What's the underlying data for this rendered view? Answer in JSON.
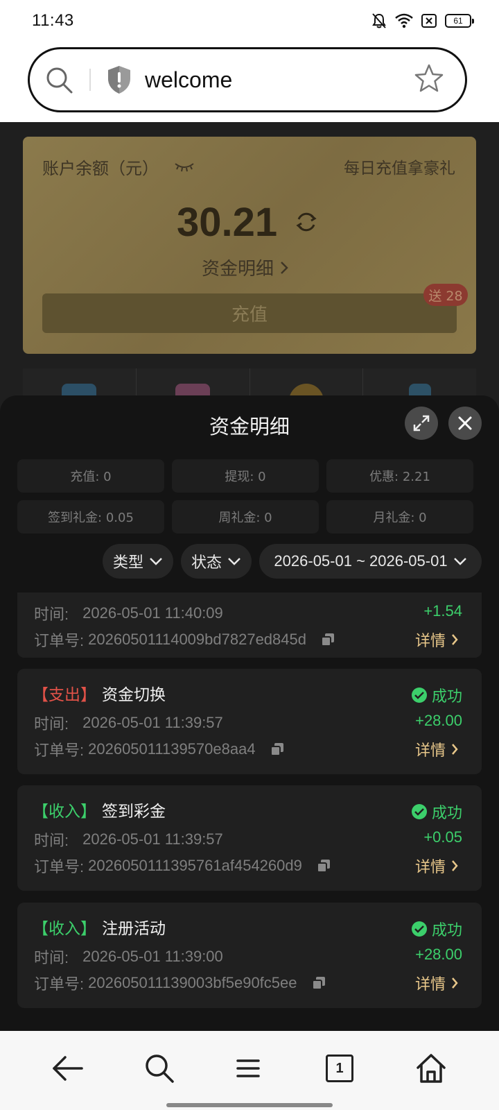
{
  "status_bar": {
    "time": "11:43",
    "battery": "61",
    "icons": [
      "bell-off-icon",
      "wifi-icon",
      "close-box-icon",
      "battery-icon"
    ]
  },
  "address_bar": {
    "text": "welcome",
    "icons": [
      "search-icon",
      "shield-warning-icon",
      "star-icon"
    ]
  },
  "balance": {
    "label": "账户余额（元）",
    "promo": "每日充值拿豪礼",
    "amount": "30.21",
    "detail_link": "资金明细",
    "recharge_label": "充值",
    "gift_badge": "送 28"
  },
  "sheet": {
    "title": "资金明细",
    "stats": [
      {
        "text": "充值: 0"
      },
      {
        "text": "提现: 0"
      },
      {
        "text": "优惠: 2.21"
      },
      {
        "text": "签到礼金: 0.05"
      },
      {
        "text": "周礼金: 0"
      },
      {
        "text": "月礼金: 0"
      }
    ],
    "filters": {
      "type": "类型",
      "status": "状态",
      "date_range": "2026-05-01 ~ 2026-05-01"
    },
    "records": [
      {
        "time_label": "时间:",
        "time": "2026-05-01 11:40:09",
        "order_label": "订单号:",
        "order": "20260501114009bd7827ed845d",
        "amount": "+1.54",
        "detail": "详情"
      },
      {
        "tag": "【支出】",
        "name": "资金切换",
        "status": "成功",
        "time_label": "时间:",
        "time": "2026-05-01 11:39:57",
        "order_label": "订单号:",
        "order": "202605011139570e8aa4",
        "amount": "+28.00",
        "detail": "详情"
      },
      {
        "tag": "【收入】",
        "name": "签到彩金",
        "status": "成功",
        "time_label": "时间:",
        "time": "2026-05-01 11:39:57",
        "order_label": "订单号:",
        "order": "2026050111395761af454260d9",
        "amount": "+0.05",
        "detail": "详情"
      },
      {
        "tag": "【收入】",
        "name": "注册活动",
        "status": "成功",
        "time_label": "时间:",
        "time": "2026-05-01 11:39:00",
        "order_label": "订单号:",
        "order": "202605011139003bf5e90fc5ee",
        "amount": "+28.00",
        "detail": "详情"
      }
    ]
  },
  "bottom_nav": {
    "tab_count": "1",
    "items": [
      "back-arrow-icon",
      "search-icon",
      "menu-icon",
      "tabs-icon",
      "home-icon"
    ]
  },
  "colors": {
    "income": "#3ccf6b",
    "expense": "#e25248",
    "detail_link": "#e8c78a",
    "card_gold": "#8b7a4c"
  }
}
